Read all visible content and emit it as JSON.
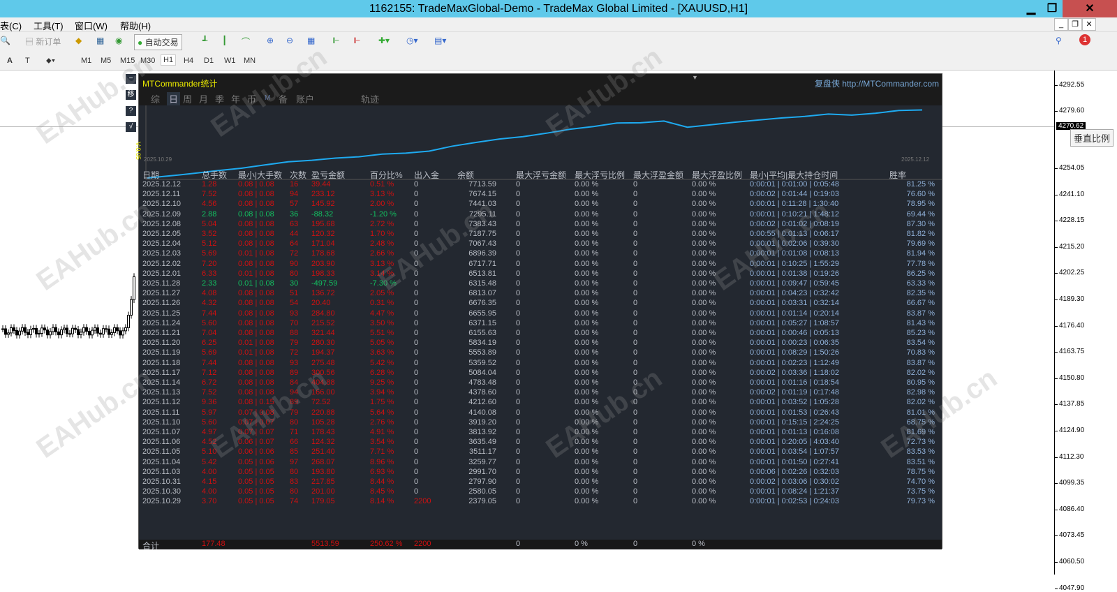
{
  "window": {
    "title": "1162155: TradeMaxGlobal-Demo - TradeMax Global Limited - [XAUUSD,H1]"
  },
  "menu": [
    "表(C)",
    "工具(T)",
    "窗口(W)",
    "帮助(H)"
  ],
  "toolbar": {
    "new_order": "新订单",
    "auto_trade": "自动交易"
  },
  "timeframes": [
    "M1",
    "M5",
    "M15",
    "M30",
    "H1",
    "H4",
    "D1",
    "W1",
    "MN"
  ],
  "active_timeframe": "H1",
  "price_axis": [
    "4292.55",
    "4279.60",
    "4254.05",
    "4241.10",
    "4228.15",
    "4215.20",
    "4202.25",
    "4189.30",
    "4176.40",
    "4163.75",
    "4150.80",
    "4137.85",
    "4124.90",
    "4112.30",
    "4099.35",
    "4086.40",
    "4073.45",
    "4060.50",
    "4047.90"
  ],
  "current_price": "4270.62",
  "vertical_scale": "垂直比例",
  "notification_count": "1",
  "side_buttons": [
    "−",
    "移",
    "?",
    "√"
  ],
  "panel": {
    "title": "MTCommander统计",
    "brand": "复盘侠 http://MTCommander.com",
    "tabs": [
      "综",
      "日",
      "周",
      "月",
      "季",
      "年",
      "币",
      "M",
      "备",
      "账户",
      "轨迹"
    ],
    "active_tab": "日",
    "chart_ylabel": "V:0.05",
    "chart_start": "2025.10.29",
    "chart_end": "2025.12.12"
  },
  "table": {
    "headers": [
      "日期",
      "总手数",
      "最小|大手数",
      "次数",
      "盈亏金额",
      "百分比%",
      "出入金",
      "余额",
      "最大浮亏金额",
      "最大浮亏比例",
      "最大浮盈金额",
      "最大浮盈比例",
      "最小|平均|最大持仓时间",
      "胜率"
    ],
    "rows": [
      [
        "2025.12.12",
        "1.28",
        "0.08 | 0.08",
        "16",
        "39.44",
        "0.51 %",
        "0",
        "7713.59",
        "0",
        "0.00 %",
        "0",
        "0.00 %",
        "0:00:01 | 0:01:00 | 0:05:48",
        "81.25 %"
      ],
      [
        "2025.12.11",
        "7.52",
        "0.08 | 0.08",
        "94",
        "233.12",
        "3.13 %",
        "0",
        "7674.15",
        "0",
        "0.00 %",
        "0",
        "0.00 %",
        "0:00:02 | 0:01:44 | 0:19:03",
        "76.60 %"
      ],
      [
        "2025.12.10",
        "4.56",
        "0.08 | 0.08",
        "57",
        "145.92",
        "2.00 %",
        "0",
        "7441.03",
        "0",
        "0.00 %",
        "0",
        "0.00 %",
        "0:00:01 | 0:11:28 | 1:30:40",
        "78.95 %"
      ],
      [
        "2025.12.09",
        "2.88",
        "0.08 | 0.08",
        "36",
        "-88.32",
        "-1.20 %",
        "0",
        "7295.11",
        "0",
        "0.00 %",
        "0",
        "0.00 %",
        "0:00:01 | 0:10:21 | 1:48:12",
        "69.44 %"
      ],
      [
        "2025.12.08",
        "5.04",
        "0.08 | 0.08",
        "63",
        "195.68",
        "2.72 %",
        "0",
        "7383.43",
        "0",
        "0.00 %",
        "0",
        "0.00 %",
        "0:00:02 | 0:01:02 | 0:08:19",
        "87.30 %"
      ],
      [
        "2025.12.05",
        "3.52",
        "0.08 | 0.08",
        "44",
        "120.32",
        "1.70 %",
        "0",
        "7187.75",
        "0",
        "0.00 %",
        "0",
        "0.00 %",
        "0:00:55 | 0:01:13 | 0:06:17",
        "81.82 %"
      ],
      [
        "2025.12.04",
        "5.12",
        "0.08 | 0.08",
        "64",
        "171.04",
        "2.48 %",
        "0",
        "7067.43",
        "0",
        "0.00 %",
        "0",
        "0.00 %",
        "0:00:01 | 0:02:06 | 0:39:30",
        "79.69 %"
      ],
      [
        "2025.12.03",
        "5.69",
        "0.01 | 0.08",
        "72",
        "178.68",
        "2.66 %",
        "0",
        "6896.39",
        "0",
        "0.00 %",
        "0",
        "0.00 %",
        "0:00:01 | 0:01:08 | 0:08:13",
        "81.94 %"
      ],
      [
        "2025.12.02",
        "7.20",
        "0.08 | 0.08",
        "90",
        "203.90",
        "3.13 %",
        "0",
        "6717.71",
        "0",
        "0.00 %",
        "0",
        "0.00 %",
        "0:00:01 | 0:10:25 | 1:55:29",
        "77.78 %"
      ],
      [
        "2025.12.01",
        "6.33",
        "0.01 | 0.08",
        "80",
        "198.33",
        "3.14 %",
        "0",
        "6513.81",
        "0",
        "0.00 %",
        "0",
        "0.00 %",
        "0:00:01 | 0:01:38 | 0:19:26",
        "86.25 %"
      ],
      [
        "2025.11.28",
        "2.33",
        "0.01 | 0.08",
        "30",
        "-497.59",
        "-7.30 %",
        "0",
        "6315.48",
        "0",
        "0.00 %",
        "0",
        "0.00 %",
        "0:00:01 | 0:09:47 | 0:59:45",
        "63.33 %"
      ],
      [
        "2025.11.27",
        "4.08",
        "0.08 | 0.08",
        "51",
        "136.72",
        "2.05 %",
        "0",
        "6813.07",
        "0",
        "0.00 %",
        "0",
        "0.00 %",
        "0:00:01 | 0:04:23 | 0:32:42",
        "82.35 %"
      ],
      [
        "2025.11.26",
        "4.32",
        "0.08 | 0.08",
        "54",
        "20.40",
        "0.31 %",
        "0",
        "6676.35",
        "0",
        "0.00 %",
        "0",
        "0.00 %",
        "0:00:01 | 0:03:31 | 0:32:14",
        "66.67 %"
      ],
      [
        "2025.11.25",
        "7.44",
        "0.08 | 0.08",
        "93",
        "284.80",
        "4.47 %",
        "0",
        "6655.95",
        "0",
        "0.00 %",
        "0",
        "0.00 %",
        "0:00:01 | 0:01:14 | 0:20:14",
        "83.87 %"
      ],
      [
        "2025.11.24",
        "5.60",
        "0.08 | 0.08",
        "70",
        "215.52",
        "3.50 %",
        "0",
        "6371.15",
        "0",
        "0.00 %",
        "0",
        "0.00 %",
        "0:00:01 | 0:05:27 | 1:08:57",
        "81.43 %"
      ],
      [
        "2025.11.21",
        "7.04",
        "0.08 | 0.08",
        "88",
        "321.44",
        "5.51 %",
        "0",
        "6155.63",
        "0",
        "0.00 %",
        "0",
        "0.00 %",
        "0:00:01 | 0:00:46 | 0:05:13",
        "85.23 %"
      ],
      [
        "2025.11.20",
        "6.25",
        "0.01 | 0.08",
        "79",
        "280.30",
        "5.05 %",
        "0",
        "5834.19",
        "0",
        "0.00 %",
        "0",
        "0.00 %",
        "0:00:01 | 0:00:23 | 0:06:35",
        "83.54 %"
      ],
      [
        "2025.11.19",
        "5.69",
        "0.01 | 0.08",
        "72",
        "194.37",
        "3.63 %",
        "0",
        "5553.89",
        "0",
        "0.00 %",
        "0",
        "0.00 %",
        "0:00:01 | 0:08:29 | 1:50:26",
        "70.83 %"
      ],
      [
        "2025.11.18",
        "7.44",
        "0.08 | 0.08",
        "93",
        "275.48",
        "5.42 %",
        "0",
        "5359.52",
        "0",
        "0.00 %",
        "0",
        "0.00 %",
        "0:00:01 | 0:02:23 | 1:12:49",
        "83.87 %"
      ],
      [
        "2025.11.17",
        "7.12",
        "0.08 | 0.08",
        "89",
        "300.56",
        "6.28 %",
        "0",
        "5084.04",
        "0",
        "0.00 %",
        "0",
        "0.00 %",
        "0:00:02 | 0:03:36 | 1:18:02",
        "82.02 %"
      ],
      [
        "2025.11.14",
        "6.72",
        "0.08 | 0.08",
        "84",
        "404.88",
        "9.25 %",
        "0",
        "4783.48",
        "0",
        "0.00 %",
        "0",
        "0.00 %",
        "0:00:01 | 0:01:16 | 0:18:54",
        "80.95 %"
      ],
      [
        "2025.11.13",
        "7.52",
        "0.08 | 0.08",
        "94",
        "166.00",
        "3.94 %",
        "0",
        "4378.60",
        "0",
        "0.00 %",
        "0",
        "0.00 %",
        "0:00:02 | 0:01:19 | 0:17:48",
        "82.98 %"
      ],
      [
        "2025.11.12",
        "9.36",
        "0.08 | 0.15",
        "89",
        "72.52",
        "1.75 %",
        "0",
        "4212.60",
        "0",
        "0.00 %",
        "0",
        "0.00 %",
        "0:00:01 | 0:03:52 | 1:05:28",
        "82.02 %"
      ],
      [
        "2025.11.11",
        "5.97",
        "0.07 | 0.08",
        "79",
        "220.88",
        "5.64 %",
        "0",
        "4140.08",
        "0",
        "0.00 %",
        "0",
        "0.00 %",
        "0:00:01 | 0:01:53 | 0:26:43",
        "81.01 %"
      ],
      [
        "2025.11.10",
        "5.60",
        "0.07 | 0.07",
        "80",
        "105.28",
        "2.76 %",
        "0",
        "3919.20",
        "0",
        "0.00 %",
        "0",
        "0.00 %",
        "0:00:01 | 0:15:15 | 2:24:25",
        "68.75 %"
      ],
      [
        "2025.11.07",
        "4.97",
        "0.07 | 0.07",
        "71",
        "178.43",
        "4.91 %",
        "0",
        "3813.92",
        "0",
        "0.00 %",
        "0",
        "0.00 %",
        "0:00:01 | 0:01:13 | 0:16:08",
        "81.69 %"
      ],
      [
        "2025.11.06",
        "4.52",
        "0.06 | 0.07",
        "66",
        "124.32",
        "3.54 %",
        "0",
        "3635.49",
        "0",
        "0.00 %",
        "0",
        "0.00 %",
        "0:00:01 | 0:20:05 | 4:03:40",
        "72.73 %"
      ],
      [
        "2025.11.05",
        "5.10",
        "0.06 | 0.06",
        "85",
        "251.40",
        "7.71 %",
        "0",
        "3511.17",
        "0",
        "0.00 %",
        "0",
        "0.00 %",
        "0:00:01 | 0:03:54 | 1:07:57",
        "83.53 %"
      ],
      [
        "2025.11.04",
        "5.42",
        "0.05 | 0.06",
        "97",
        "268.07",
        "8.96 %",
        "0",
        "3259.77",
        "0",
        "0.00 %",
        "0",
        "0.00 %",
        "0:00:01 | 0:01:50 | 0:27:41",
        "83.51 %"
      ],
      [
        "2025.11.03",
        "4.00",
        "0.05 | 0.05",
        "80",
        "193.80",
        "6.93 %",
        "0",
        "2991.70",
        "0",
        "0.00 %",
        "0",
        "0.00 %",
        "0:00:06 | 0:02:26 | 0:32:03",
        "78.75 %"
      ],
      [
        "2025.10.31",
        "4.15",
        "0.05 | 0.05",
        "83",
        "217.85",
        "8.44 %",
        "0",
        "2797.90",
        "0",
        "0.00 %",
        "0",
        "0.00 %",
        "0:00:02 | 0:03:06 | 0:30:02",
        "74.70 %"
      ],
      [
        "2025.10.30",
        "4.00",
        "0.05 | 0.05",
        "80",
        "201.00",
        "8.45 %",
        "0",
        "2580.05",
        "0",
        "0.00 %",
        "0",
        "0.00 %",
        "0:00:01 | 0:08:24 | 1:21:37",
        "73.75 %"
      ],
      [
        "2025.10.29",
        "3.70",
        "0.05 | 0.05",
        "74",
        "179.05",
        "8.14 %",
        "2200",
        "2379.05",
        "0",
        "0.00 %",
        "0",
        "0.00 %",
        "0:00:01 | 0:02:53 | 0:24:03",
        "79.73 %"
      ]
    ],
    "total": {
      "label": "合计",
      "lots": "177.48",
      "pnl": "5513.59",
      "pct": "250.62 %",
      "inout": "2200",
      "max_float_loss": "0",
      "max_float_loss_pct": "0 %",
      "max_float_profit": "0",
      "max_float_profit_pct": "0 %"
    }
  },
  "colors": {
    "profit": "#d01010",
    "loss": "#12c060",
    "curve": "#1eaaf0",
    "title_bar": "#5fc9ea"
  }
}
